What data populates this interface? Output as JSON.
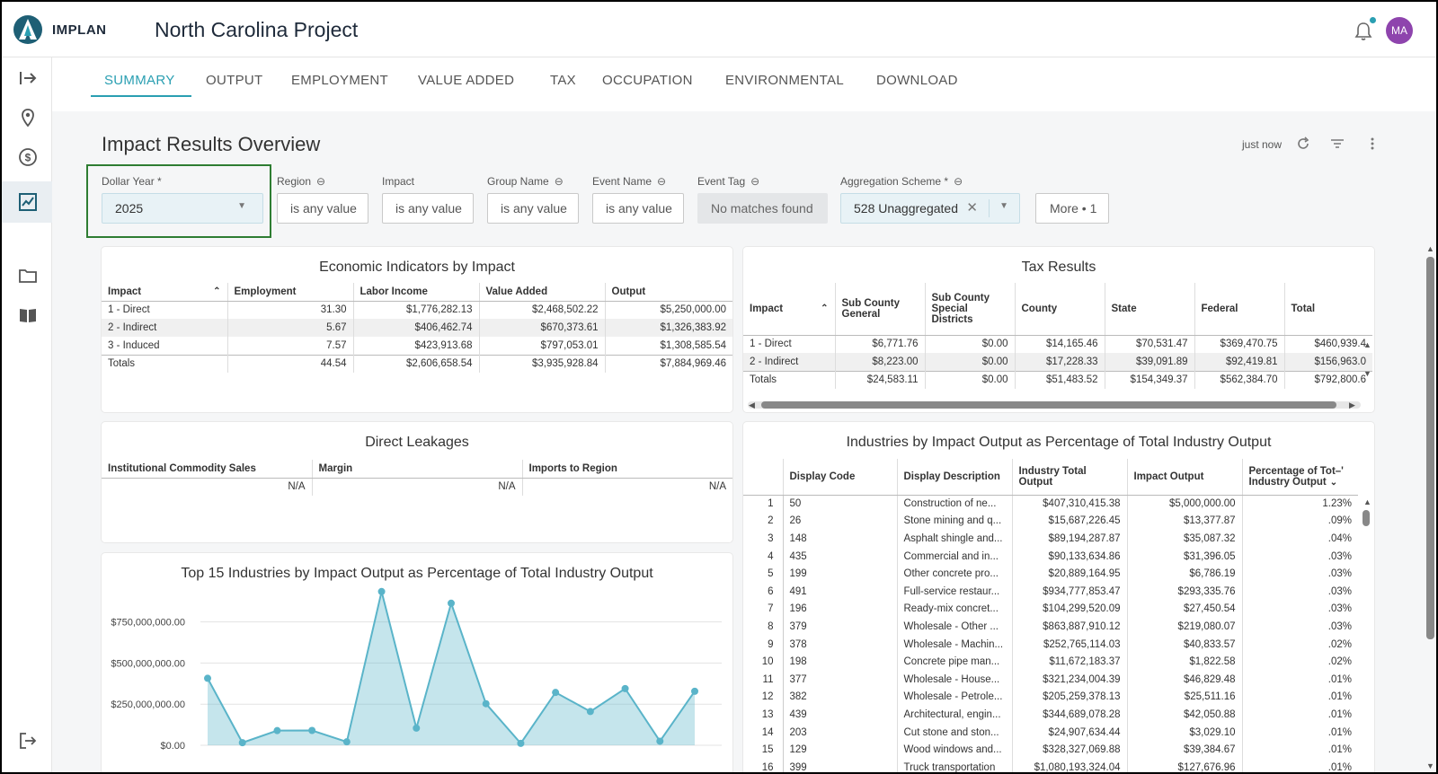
{
  "app": {
    "brand": "IMPLAN",
    "project_title": "North Carolina Project",
    "avatar_initials": "MA"
  },
  "tabs": [
    {
      "label": "SUMMARY",
      "active": true
    },
    {
      "label": "OUTPUT"
    },
    {
      "label": "EMPLOYMENT"
    },
    {
      "label": "VALUE ADDED"
    },
    {
      "label": "TAX"
    },
    {
      "label": "OCCUPATION"
    },
    {
      "label": "ENVIRONMENTAL"
    },
    {
      "label": "DOWNLOAD"
    }
  ],
  "header": {
    "title": "Impact Results Overview",
    "refreshed": "just now"
  },
  "filters": {
    "dollar_year": {
      "label": "Dollar Year *",
      "value": "2025"
    },
    "region": {
      "label": "Region",
      "value": "is any value"
    },
    "impact": {
      "label": "Impact",
      "value": "is any value"
    },
    "group_name": {
      "label": "Group Name",
      "value": "is any value"
    },
    "event_name": {
      "label": "Event Name",
      "value": "is any value"
    },
    "event_tag": {
      "label": "Event Tag",
      "value": "No matches found"
    },
    "aggregation": {
      "label": "Aggregation Scheme *",
      "value": "528 Unaggregated"
    },
    "more": "More • 1"
  },
  "economic": {
    "title": "Economic Indicators by Impact",
    "headers": [
      "Impact",
      "Employment",
      "Labor Income",
      "Value Added",
      "Output"
    ],
    "rows": [
      [
        "1 - Direct",
        "31.30",
        "$1,776,282.13",
        "$2,468,502.22",
        "$5,250,000.00"
      ],
      [
        "2 - Indirect",
        "5.67",
        "$406,462.74",
        "$670,373.61",
        "$1,326,383.92"
      ],
      [
        "3 - Induced",
        "7.57",
        "$423,913.68",
        "$797,053.01",
        "$1,308,585.54"
      ]
    ],
    "totals": [
      "Totals",
      "44.54",
      "$2,606,658.54",
      "$3,935,928.84",
      "$7,884,969.46"
    ]
  },
  "tax": {
    "title": "Tax Results",
    "headers": [
      "Impact",
      "Sub County General",
      "Sub County Special Districts",
      "County",
      "State",
      "Federal",
      "Total"
    ],
    "rows": [
      [
        "1 - Direct",
        "$6,771.76",
        "$0.00",
        "$14,165.46",
        "$70,531.47",
        "$369,470.75",
        "$460,939.4"
      ],
      [
        "2 - Indirect",
        "$8,223.00",
        "$0.00",
        "$17,228.33",
        "$39,091.89",
        "$92,419.81",
        "$156,963.0"
      ]
    ],
    "totals": [
      "Totals",
      "$24,583.11",
      "$0.00",
      "$51,483.52",
      "$154,349.37",
      "$562,384.70",
      "$792,800.6"
    ]
  },
  "leakages": {
    "title": "Direct Leakages",
    "headers": [
      "Institutional Commodity Sales",
      "Margin",
      "Imports to Region"
    ],
    "values": [
      "N/A",
      "N/A",
      "N/A"
    ]
  },
  "industries": {
    "title": "Industries by Impact Output as Percentage of Total Industry Output",
    "headers": [
      "Display Code",
      "Display Description",
      "Industry Total Output",
      "Impact Output",
      "Percentage of Tot–' Industry Output"
    ],
    "rows": [
      [
        "1",
        "50",
        "Construction of ne...",
        "$407,310,415.38",
        "$5,000,000.00",
        "1.23%"
      ],
      [
        "2",
        "26",
        "Stone mining and q...",
        "$15,687,226.45",
        "$13,377.87",
        ".09%"
      ],
      [
        "3",
        "148",
        "Asphalt shingle and...",
        "$89,194,287.87",
        "$35,087.32",
        ".04%"
      ],
      [
        "4",
        "435",
        "Commercial and in...",
        "$90,133,634.86",
        "$31,396.05",
        ".03%"
      ],
      [
        "5",
        "199",
        "Other concrete pro...",
        "$20,889,164.95",
        "$6,786.19",
        ".03%"
      ],
      [
        "6",
        "491",
        "Full-service restaur...",
        "$934,777,853.47",
        "$293,335.76",
        ".03%"
      ],
      [
        "7",
        "196",
        "Ready-mix concret...",
        "$104,299,520.09",
        "$27,450.54",
        ".03%"
      ],
      [
        "8",
        "379",
        "Wholesale - Other ...",
        "$863,887,910.12",
        "$219,080.07",
        ".03%"
      ],
      [
        "9",
        "378",
        "Wholesale - Machin...",
        "$252,765,114.03",
        "$40,833.57",
        ".02%"
      ],
      [
        "10",
        "198",
        "Concrete pipe man...",
        "$11,672,183.37",
        "$1,822.58",
        ".02%"
      ],
      [
        "11",
        "377",
        "Wholesale - House...",
        "$321,234,004.39",
        "$46,829.48",
        ".01%"
      ],
      [
        "12",
        "382",
        "Wholesale - Petrole...",
        "$205,259,378.13",
        "$25,511.16",
        ".01%"
      ],
      [
        "13",
        "439",
        "Architectural, engin...",
        "$344,689,078.28",
        "$42,050.88",
        ".01%"
      ],
      [
        "14",
        "203",
        "Cut stone and ston...",
        "$24,907,634.44",
        "$3,029.10",
        ".01%"
      ],
      [
        "15",
        "129",
        "Wood windows and...",
        "$328,327,069.88",
        "$39,384.67",
        ".01%"
      ],
      [
        "16",
        "399",
        "Truck transportation",
        "$1,080,193,324.04",
        "$127,676.96",
        ".01%"
      ]
    ]
  },
  "chart_data": {
    "type": "area",
    "title": "Top 15 Industries by Impact Output as Percentage of Total Industry Output",
    "xlabel": "",
    "ylabel": "",
    "y_ticks": [
      "$750,000,000.00",
      "$500,000,000.00",
      "$250,000,000.00",
      "$0.00"
    ],
    "ylim": [
      0,
      950000000
    ],
    "series": [
      {
        "values": [
          407310415,
          15687226,
          89194288,
          90133635,
          20889165,
          934777853,
          104299520,
          863887910,
          252765114,
          11672183,
          321234004,
          205259378,
          344689078,
          24907634,
          328327070
        ]
      }
    ],
    "color": "#5ab4c9"
  }
}
